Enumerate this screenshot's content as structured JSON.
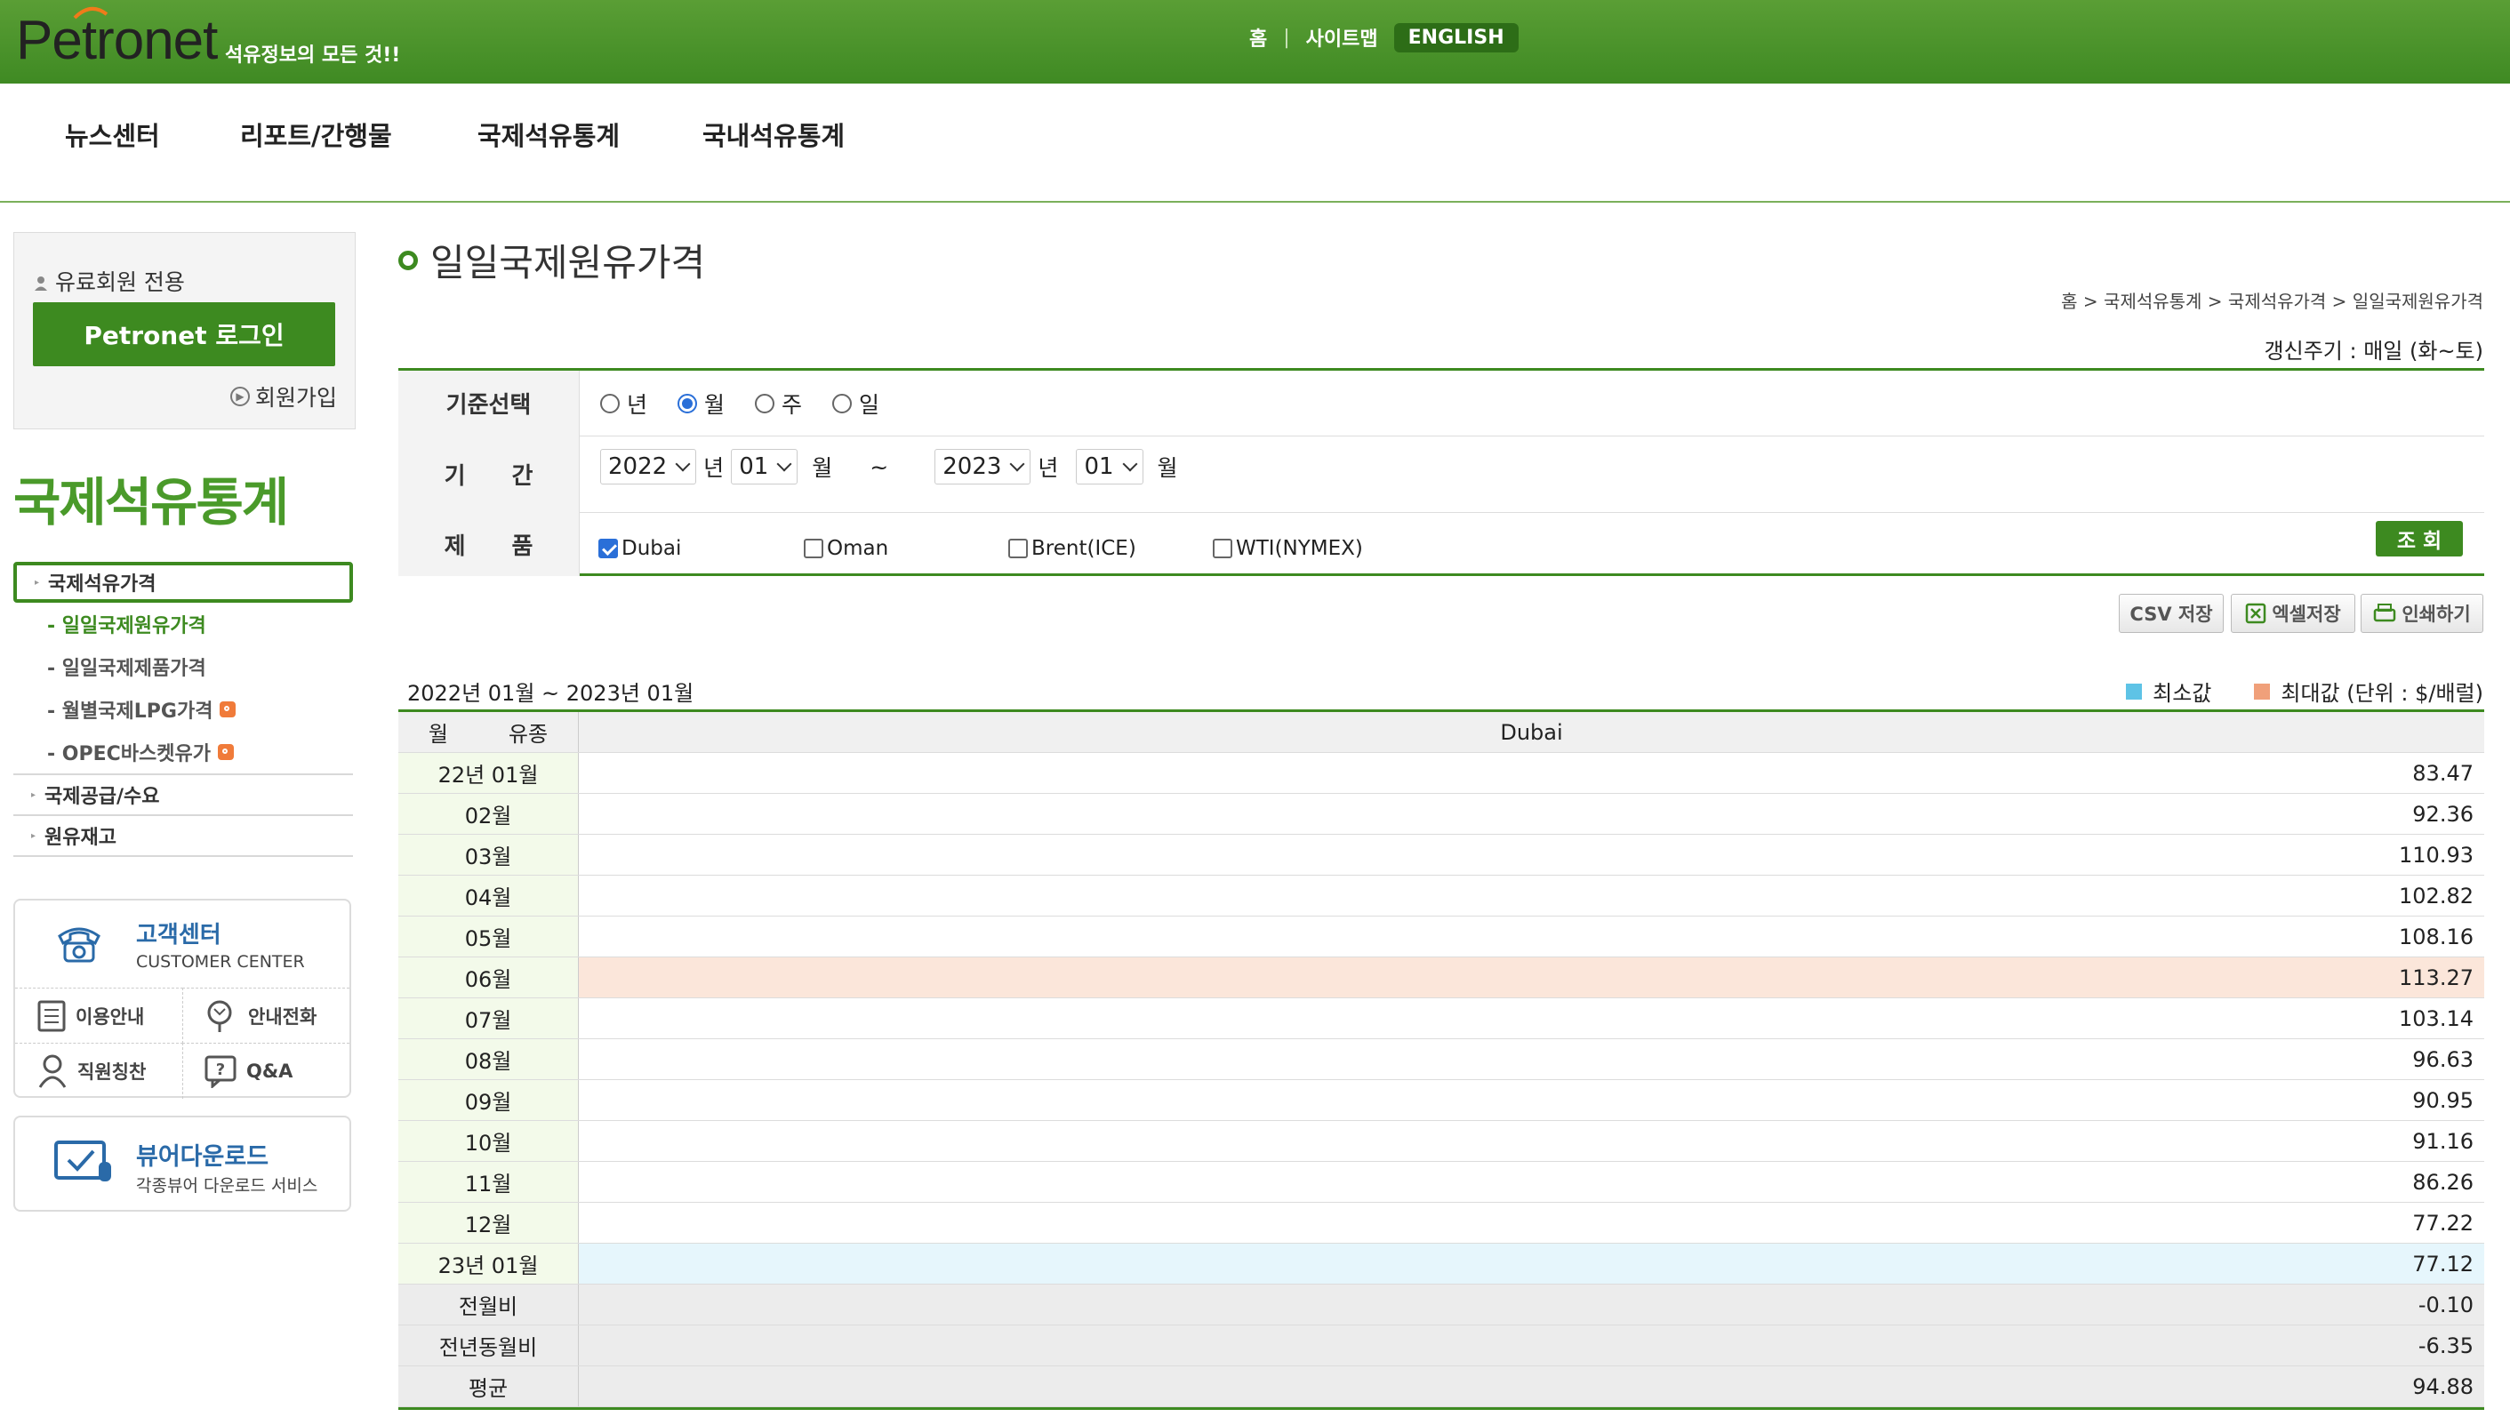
{
  "header": {
    "logo": "Petronet",
    "slogan": "석유정보의 모든 것!!",
    "links": {
      "home": "홈",
      "sep": "|",
      "sitemap": "사이트맵",
      "english": "ENGLISH"
    },
    "nav": [
      "뉴스센터",
      "리포트/간행물",
      "국제석유통계",
      "국내석유통계"
    ],
    "brand_color": "#3f8a23"
  },
  "sidebar": {
    "login": {
      "label": "유료회원 전용",
      "button": "Petronet 로그인",
      "join": "회원가입"
    },
    "title": "국제석유통계",
    "menu": [
      {
        "label": "국제석유가격",
        "subs": [
          "- 일일국제원유가격",
          "- 일일국제제품가격",
          "- 월별국제LPG가격",
          "- OPEC바스켓유가"
        ]
      },
      {
        "label": "국제공급/수요"
      },
      {
        "label": "원유재고"
      }
    ],
    "customer": {
      "title": "고객센터",
      "subtitle": "CUSTOMER CENTER",
      "items": [
        "이용안내",
        "안내전화",
        "직원칭찬",
        "Q&A"
      ]
    },
    "viewer": {
      "title": "뷰어다운로드",
      "subtitle": "각종뷰어 다운로드 서비스"
    }
  },
  "content": {
    "title": "일일국제원유가격",
    "breadcrumb": "홈 > 국제석유통계 > 국제석유가격 > 일일국제원유가격",
    "update_cycle": "갱신주기 : 매일 (화~토)",
    "filter": {
      "basis_label": "기준선택",
      "basis_options": [
        "년",
        "월",
        "주",
        "일"
      ],
      "basis_selected": "월",
      "period_label": "기　　간",
      "from_year": "2022",
      "from_month": "01",
      "to_year": "2023",
      "to_month": "01",
      "year_unit": "년",
      "month_unit": "월",
      "tilde": "~",
      "product_label": "제　　품",
      "products": [
        {
          "name": "Dubai",
          "checked": true
        },
        {
          "name": "Oman",
          "checked": false
        },
        {
          "name": "Brent(ICE)",
          "checked": false
        },
        {
          "name": "WTI(NYMEX)",
          "checked": false
        }
      ],
      "search_button": "조 회"
    },
    "actions": {
      "csv": "CSV 저장",
      "excel": "엑셀저장",
      "print": "인쇄하기"
    },
    "period_text": "2022년 01월 ~ 2023년 01월",
    "legend": {
      "min": "최소값",
      "max": "최대값 (단위 : $/배럴)",
      "min_color": "#5ec3e6",
      "max_color": "#f0a07a"
    },
    "table": {
      "header_month": "월",
      "header_type": "유종",
      "column": "Dubai",
      "rows": [
        {
          "month": "22년 01월",
          "value": "83.47"
        },
        {
          "month": "02월",
          "value": "92.36"
        },
        {
          "month": "03월",
          "value": "110.93"
        },
        {
          "month": "04월",
          "value": "102.82"
        },
        {
          "month": "05월",
          "value": "108.16"
        },
        {
          "month": "06월",
          "value": "113.27"
        },
        {
          "month": "07월",
          "value": "103.14"
        },
        {
          "month": "08월",
          "value": "96.63"
        },
        {
          "month": "09월",
          "value": "90.95"
        },
        {
          "month": "10월",
          "value": "91.16"
        },
        {
          "month": "11월",
          "value": "86.26"
        },
        {
          "month": "12월",
          "value": "77.22"
        },
        {
          "month": "23년 01월",
          "value": "77.12"
        },
        {
          "month": "전월비",
          "value": "-0.10"
        },
        {
          "month": "전년동월비",
          "value": "-6.35"
        },
        {
          "month": "평균",
          "value": "94.88"
        }
      ]
    }
  }
}
